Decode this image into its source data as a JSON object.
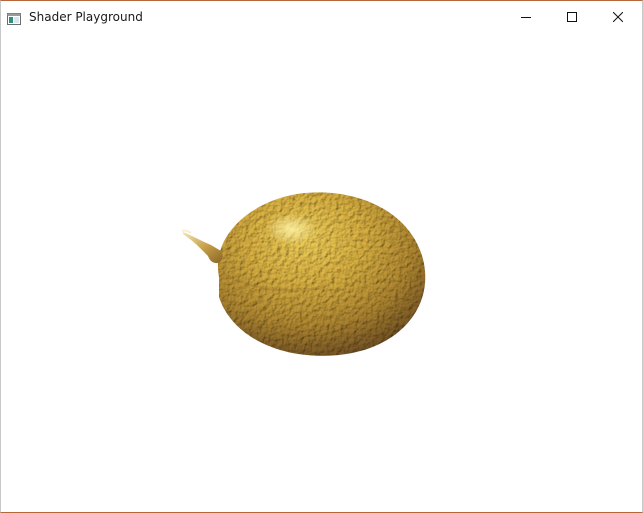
{
  "window": {
    "title": "Shader Playground",
    "controls": {
      "minimize": "minimize-icon",
      "maximize": "maximize-icon",
      "close": "close-icon"
    },
    "icon": "app-window-icon",
    "border_accent": "#b8653a"
  },
  "viewport": {
    "background": "#ffffff",
    "content": "lemon-render"
  }
}
